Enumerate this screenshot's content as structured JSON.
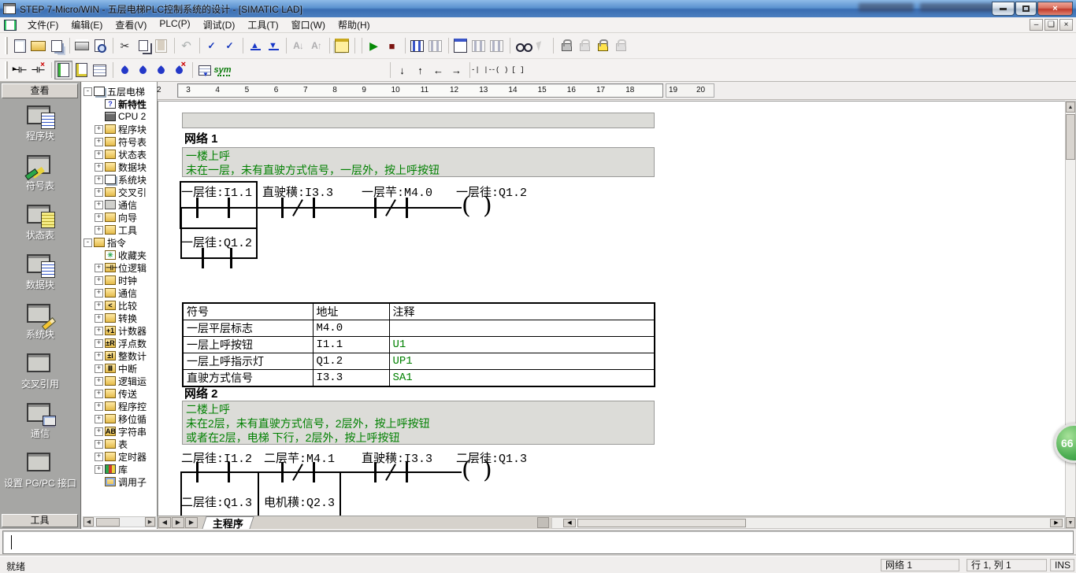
{
  "title_bar": {
    "title": "STEP 7-Micro/WIN - 五层电梯PLC控制系统的设计 - [SIMATIC LAD]"
  },
  "menu_bar": {
    "items": [
      "文件(F)",
      "编辑(E)",
      "查看(V)",
      "PLC(P)",
      "调试(D)",
      "工具(T)",
      "窗口(W)",
      "帮助(H)"
    ]
  },
  "toolbar_main": {
    "icons": [
      {
        "name": "new-icon",
        "cls": "i-page",
        "g": ""
      },
      {
        "name": "open-icon",
        "cls": "i-folder",
        "g": ""
      },
      {
        "name": "save-all-icon",
        "cls": "i-stack",
        "g": ""
      },
      {
        "name": "toolbar-separator",
        "cls": "sep",
        "g": ""
      },
      {
        "name": "print-icon",
        "cls": "i-print",
        "g": ""
      },
      {
        "name": "print-preview-icon",
        "cls": "i-prevw",
        "g": ""
      },
      {
        "name": "toolbar-separator",
        "cls": "sep",
        "g": ""
      },
      {
        "name": "cut-icon",
        "cls": "i-cut",
        "g": "✂"
      },
      {
        "name": "copy-icon",
        "cls": "i-copy",
        "g": ""
      },
      {
        "name": "paste-icon",
        "cls": "i-paste dim",
        "g": ""
      },
      {
        "name": "toolbar-separator",
        "cls": "sep",
        "g": ""
      },
      {
        "name": "undo-icon",
        "cls": "i-undo dim",
        "g": "↶"
      },
      {
        "name": "toolbar-separator",
        "cls": "sep",
        "g": ""
      },
      {
        "name": "compile-icon",
        "cls": "i-chk",
        "g": "✓"
      },
      {
        "name": "compile-all-icon",
        "cls": "i-chk2",
        "g": "✓"
      },
      {
        "name": "toolbar-separator",
        "cls": "sep",
        "g": ""
      },
      {
        "name": "upload-icon",
        "cls": "i-up",
        "g": "▲"
      },
      {
        "name": "download-icon",
        "cls": "i-down",
        "g": "▼"
      },
      {
        "name": "toolbar-separator",
        "cls": "sep",
        "g": ""
      },
      {
        "name": "sort-descending-icon",
        "cls": "i-sort dim",
        "g": "A↓"
      },
      {
        "name": "sort-ascending-icon",
        "cls": "i-sort dim",
        "g": "A↑"
      },
      {
        "name": "toolbar-separator",
        "cls": "sep",
        "g": ""
      },
      {
        "name": "options-icon",
        "cls": "i-opt",
        "g": ""
      },
      {
        "name": "toolbar-separator",
        "cls": "sep",
        "g": ""
      },
      {
        "name": "toolbar-separator",
        "cls": "sep",
        "g": ""
      },
      {
        "name": "run-icon",
        "cls": "i-run",
        "g": "▶"
      },
      {
        "name": "stop-icon",
        "cls": "i-stop",
        "g": "■"
      },
      {
        "name": "toolbar-separator",
        "cls": "sep",
        "g": ""
      },
      {
        "name": "program-status-icon",
        "cls": "i-grid",
        "g": ""
      },
      {
        "name": "pause-program-status-icon",
        "cls": "i-grid dim",
        "g": ""
      },
      {
        "name": "toolbar-separator",
        "cls": "sep",
        "g": ""
      },
      {
        "name": "chart-status-icon",
        "cls": "i-win",
        "g": ""
      },
      {
        "name": "pause-chart-status-icon",
        "cls": "i-grid dim",
        "g": ""
      },
      {
        "name": "read-all-status-icon",
        "cls": "i-grid dim",
        "g": ""
      },
      {
        "name": "toolbar-separator",
        "cls": "sep",
        "g": ""
      },
      {
        "name": "monitor-glasses-icon",
        "cls": "i-glass",
        "g": ""
      },
      {
        "name": "select-pointer-icon",
        "cls": "i-cursor dim",
        "g": ""
      },
      {
        "name": "toolbar-separator",
        "cls": "sep",
        "g": ""
      },
      {
        "name": "lock-icon",
        "cls": "i-lock",
        "g": ""
      },
      {
        "name": "unlock-icon",
        "cls": "i-lock dim",
        "g": ""
      },
      {
        "name": "password-lock-icon",
        "cls": "i-locky",
        "g": ""
      },
      {
        "name": "lock-disabled-icon",
        "cls": "i-lock dim",
        "g": ""
      }
    ]
  },
  "toolbar_instruction": {
    "icons": [
      {
        "name": "insert-network-icon",
        "cls": "i-net",
        "g": "⊣⊢"
      },
      {
        "name": "delete-network-icon",
        "cls": "i-netx",
        "g": "⊣⊢"
      },
      {
        "name": "toolbar-separator",
        "cls": "sep",
        "g": ""
      },
      {
        "name": "view-lad-icon",
        "cls": "i-vlad pressed",
        "g": ""
      },
      {
        "name": "view-symbol-info-icon",
        "cls": "i-vsym",
        "g": ""
      },
      {
        "name": "view-poc-table-icon",
        "cls": "i-vtbl",
        "g": ""
      },
      {
        "name": "toolbar-separator",
        "cls": "sep",
        "g": ""
      },
      {
        "name": "bookmark-toggle-icon",
        "cls": "i-pen",
        "g": ""
      },
      {
        "name": "bookmark-next-icon",
        "cls": "i-pen",
        "g": ""
      },
      {
        "name": "bookmark-prev-icon",
        "cls": "i-pen",
        "g": ""
      },
      {
        "name": "bookmark-clear-icon",
        "cls": "i-penx",
        "g": ""
      },
      {
        "name": "toolbar-separator",
        "cls": "sep",
        "g": ""
      },
      {
        "name": "apply-symbol-table-icon",
        "cls": "i-symt",
        "g": ""
      },
      {
        "name": "symbolic-addressing-icon",
        "cls": "i-symg",
        "g": "sym"
      },
      {
        "name": "toolbar-spacer",
        "cls": "gap",
        "g": ""
      },
      {
        "name": "toolbar-separator",
        "cls": "sep",
        "g": ""
      },
      {
        "name": "line-down-icon",
        "cls": "i-ar",
        "g": "↓"
      },
      {
        "name": "line-up-icon",
        "cls": "i-ar",
        "g": "↑"
      },
      {
        "name": "line-left-icon",
        "cls": "i-ar",
        "g": "←"
      },
      {
        "name": "line-right-icon",
        "cls": "i-ar",
        "g": "→"
      },
      {
        "name": "toolbar-separator",
        "cls": "sep",
        "g": ""
      },
      {
        "name": "insert-contact-icon",
        "cls": "i-ct",
        "g": "-| |-"
      },
      {
        "name": "insert-coil-icon",
        "cls": "i-ct",
        "g": "-( )"
      },
      {
        "name": "insert-box-icon",
        "cls": "i-ct",
        "g": "[ ]"
      }
    ]
  },
  "view_bar": {
    "header": "查看",
    "footer": "工具",
    "items": [
      {
        "label": "程序块",
        "cls": "sb-doc",
        "name": "viewbar-program-block",
        "art": "win"
      },
      {
        "label": "符号表",
        "cls": "sb-pens",
        "name": "viewbar-symbol-table",
        "art": "tbl"
      },
      {
        "label": "状态表",
        "cls": "sb-docy",
        "name": "viewbar-status-chart",
        "art": "win"
      },
      {
        "label": "数据块",
        "cls": "sb-doc",
        "name": "viewbar-data-block",
        "art": "win"
      },
      {
        "label": "系统块",
        "cls": "sb-pencil",
        "name": "viewbar-system-block",
        "art": "win"
      },
      {
        "label": "交叉引用",
        "cls": "sb-xref",
        "name": "viewbar-cross-reference",
        "art": "pagey"
      },
      {
        "label": "通信",
        "cls": "sb-pc",
        "name": "viewbar-communications",
        "art": "win"
      },
      {
        "label": "设置 PG/PC 接口",
        "cls": "sb-pgpc",
        "name": "viewbar-set-pgpc-interface",
        "art": "slats"
      }
    ]
  },
  "project_tree": {
    "items": [
      {
        "lv": "lvl0",
        "e": "-",
        "ic": "t-root",
        "g": "",
        "label": "五层电梯",
        "b": ""
      },
      {
        "lv": "lvl1",
        "e": "",
        "ic": "t-help",
        "g": "?",
        "label": "新特性",
        "b": "b"
      },
      {
        "lv": "lvl1",
        "e": "",
        "ic": "t-cpu",
        "g": "",
        "label": "CPU 2",
        "b": ""
      },
      {
        "lv": "lvl1",
        "e": "+",
        "ic": "t-f",
        "g": "",
        "label": "程序块",
        "b": ""
      },
      {
        "lv": "lvl1",
        "e": "+",
        "ic": "t-f",
        "g": "",
        "label": "符号表",
        "b": ""
      },
      {
        "lv": "lvl1",
        "e": "+",
        "ic": "t-f",
        "g": "",
        "label": "状态表",
        "b": ""
      },
      {
        "lv": "lvl1",
        "e": "+",
        "ic": "t-f",
        "g": "",
        "label": "数据块",
        "b": ""
      },
      {
        "lv": "lvl1",
        "e": "+",
        "ic": "t-root",
        "g": "",
        "label": "系统块",
        "b": ""
      },
      {
        "lv": "lvl1",
        "e": "+",
        "ic": "t-f",
        "g": "",
        "label": "交叉引",
        "b": ""
      },
      {
        "lv": "lvl1",
        "e": "+",
        "ic": "t-cm",
        "g": "",
        "label": "通信",
        "b": ""
      },
      {
        "lv": "lvl1",
        "e": "+",
        "ic": "t-f",
        "g": "",
        "label": "向导",
        "b": ""
      },
      {
        "lv": "lvl1",
        "e": "+",
        "ic": "t-f",
        "g": "",
        "label": "工具",
        "b": ""
      },
      {
        "lv": "lvl0",
        "e": "-",
        "ic": "t-f",
        "g": "",
        "label": "指令",
        "b": ""
      },
      {
        "lv": "lvl1",
        "e": "",
        "ic": "t-fav",
        "g": "✳",
        "label": "收藏夹",
        "b": ""
      },
      {
        "lv": "lvl1",
        "e": "+",
        "ic": "t-f",
        "g": "⊣⊢",
        "label": "位逻辑",
        "b": ""
      },
      {
        "lv": "lvl1",
        "e": "+",
        "ic": "t-f",
        "g": "",
        "label": "时钟",
        "b": ""
      },
      {
        "lv": "lvl1",
        "e": "+",
        "ic": "t-f",
        "g": "",
        "label": "通信",
        "b": ""
      },
      {
        "lv": "lvl1",
        "e": "+",
        "ic": "t-f",
        "g": "<",
        "label": "比较",
        "b": ""
      },
      {
        "lv": "lvl1",
        "e": "+",
        "ic": "t-f",
        "g": "",
        "label": "转换",
        "b": ""
      },
      {
        "lv": "lvl1",
        "e": "+",
        "ic": "t-f",
        "g": "+1",
        "label": "计数器",
        "b": ""
      },
      {
        "lv": "lvl1",
        "e": "+",
        "ic": "t-f",
        "g": "±R",
        "label": "浮点数",
        "b": ""
      },
      {
        "lv": "lvl1",
        "e": "+",
        "ic": "t-f",
        "g": "±I",
        "label": "整数计",
        "b": ""
      },
      {
        "lv": "lvl1",
        "e": "+",
        "ic": "t-f",
        "g": "Ⅲ",
        "label": "中断",
        "b": ""
      },
      {
        "lv": "lvl1",
        "e": "+",
        "ic": "t-f",
        "g": "",
        "label": "逻辑运",
        "b": ""
      },
      {
        "lv": "lvl1",
        "e": "+",
        "ic": "t-f",
        "g": "",
        "label": "传送",
        "b": ""
      },
      {
        "lv": "lvl1",
        "e": "+",
        "ic": "t-f",
        "g": "",
        "label": "程序控",
        "b": ""
      },
      {
        "lv": "lvl1",
        "e": "+",
        "ic": "t-f",
        "g": "",
        "label": "移位循",
        "b": ""
      },
      {
        "lv": "lvl1",
        "e": "+",
        "ic": "t-f",
        "g": "AB",
        "label": "字符串",
        "b": ""
      },
      {
        "lv": "lvl1",
        "e": "+",
        "ic": "t-f",
        "g": "",
        "label": "表",
        "b": ""
      },
      {
        "lv": "lvl1",
        "e": "+",
        "ic": "t-f",
        "g": "",
        "label": "定时器",
        "b": ""
      },
      {
        "lv": "lvl1",
        "e": "+",
        "ic": "t-lib",
        "g": "",
        "label": "库",
        "b": ""
      },
      {
        "lv": "lvl1",
        "e": "",
        "ic": "t-call",
        "g": "",
        "label": "调用子",
        "b": ""
      }
    ]
  },
  "ruler": {
    "numbers": [
      2,
      3,
      4,
      5,
      6,
      7,
      8,
      9,
      10,
      11,
      12,
      13,
      14,
      15,
      16,
      17,
      18,
      19,
      20
    ]
  },
  "ladder": {
    "networks": [
      {
        "title": "网络 1",
        "comment": [
          "一楼上呼",
          "未在一层，未有直驶方式信号，一层外，按上呼按钮"
        ],
        "contacts": [
          {
            "label": "一层徍:I1.1",
            "type": "NO"
          },
          {
            "label": "直驶穔:I3.3",
            "type": "NC"
          },
          {
            "label": "一层芉:M4.0",
            "type": "NC"
          }
        ],
        "coil": {
          "label": "一层徍:Q1.2"
        },
        "branch_contacts": [
          {
            "label": "一层徍:Q1.2",
            "type": "NO"
          }
        ]
      },
      {
        "title": "网络 2",
        "comment": [
          "二楼上呼",
          "未在2层，未有直驶方式信号，2层外，按上呼按钮",
          "或者在2层，电梯 下行，2层外，按上呼按钮"
        ],
        "contacts": [
          {
            "label": "二层徍:I1.2",
            "type": "NO"
          },
          {
            "label": "二层芉:M4.1",
            "type": "NC"
          },
          {
            "label": "直驶穔:I3.3",
            "type": "NC"
          }
        ],
        "coil": {
          "label": "二层徍:Q1.3"
        },
        "branch_contacts": [
          {
            "label": "二层徍:Q1.3",
            "type": "NO"
          },
          {
            "label": "电机穔:Q2.3",
            "type": "NO"
          }
        ]
      }
    ],
    "symbol_table": {
      "headers": [
        "符号",
        "地址",
        "注释"
      ],
      "rows": [
        {
          "sym": "一层平层标志",
          "addr": "M4.0",
          "cmt": ""
        },
        {
          "sym": "一层上呼按钮",
          "addr": "I1.1",
          "cmt": "U1"
        },
        {
          "sym": "一层上呼指示灯",
          "addr": "Q1.2",
          "cmt": "UP1"
        },
        {
          "sym": "直驶方式信号",
          "addr": "I3.3",
          "cmt": "SA1"
        }
      ]
    }
  },
  "editor_tabs": {
    "tab": "主程序"
  },
  "status_bar": {
    "ready": "就绪",
    "network": "网络 1",
    "position": "行 1, 列 1",
    "mode": "INS"
  },
  "overlay_badge": {
    "value": "66"
  },
  "colors": {
    "comment_green": "#008000",
    "annotation_green": "#008000",
    "run_green": "#068a06",
    "stop_red": "#7c1410",
    "titlebar_blue": "#4c80c0"
  }
}
